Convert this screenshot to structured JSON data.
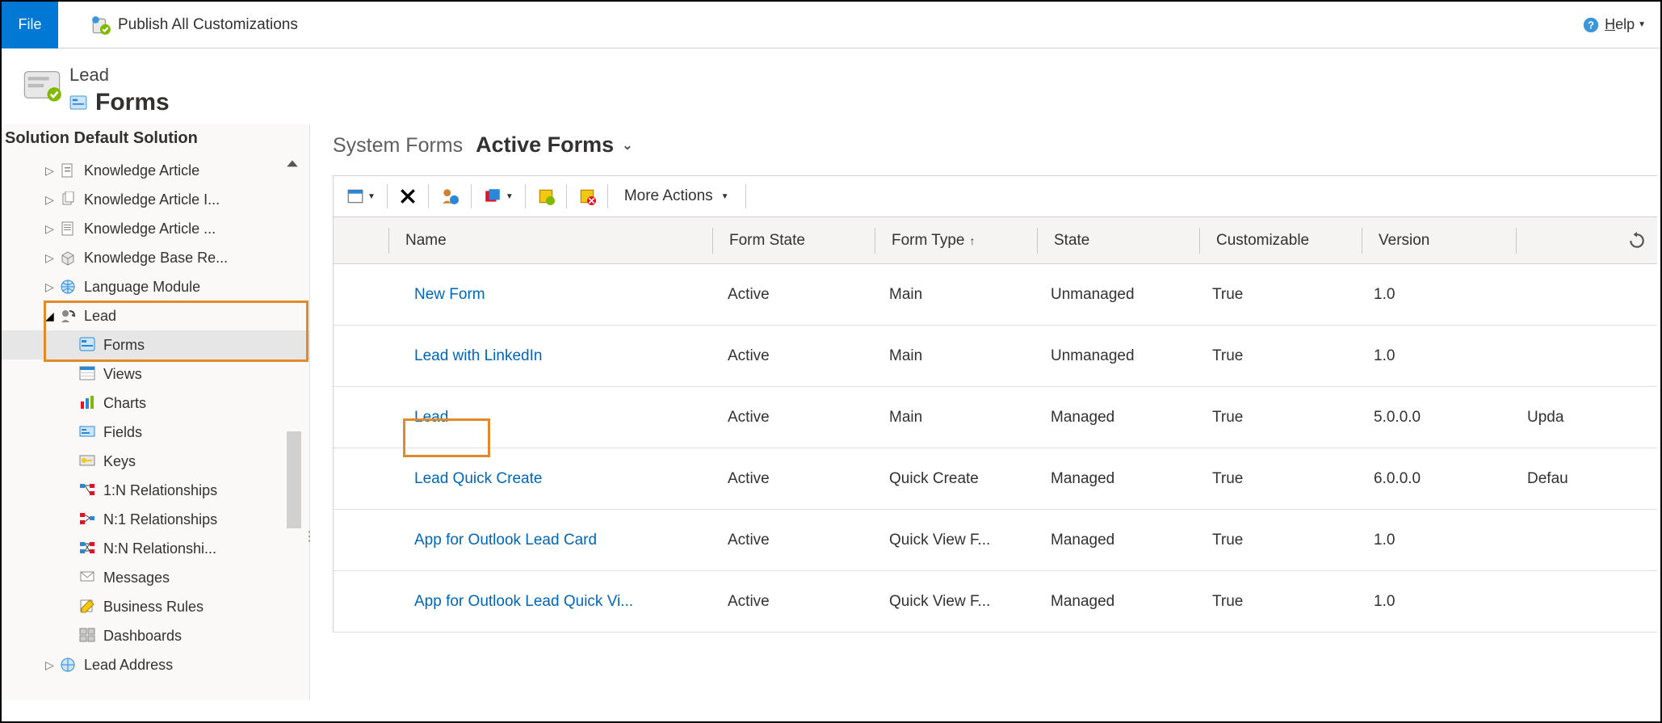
{
  "ribbon": {
    "file_label": "File",
    "publish_label": "Publish All Customizations",
    "help_label": "elp",
    "help_prefix": "H"
  },
  "header": {
    "entity_name": "Lead",
    "section_title": "Forms"
  },
  "sidebar": {
    "solution_label": "Solution Default Solution",
    "items": [
      {
        "label": "Knowledge Article",
        "icon": "doc"
      },
      {
        "label": "Knowledge Article I...",
        "icon": "doc-stack"
      },
      {
        "label": "Knowledge Article ...",
        "icon": "doc-lines"
      },
      {
        "label": "Knowledge Base Re...",
        "icon": "box"
      },
      {
        "label": "Language Module",
        "icon": "globe"
      }
    ],
    "lead_label": "Lead",
    "lead_children": [
      {
        "label": "Forms",
        "icon": "form",
        "selected": true
      },
      {
        "label": "Views",
        "icon": "view"
      },
      {
        "label": "Charts",
        "icon": "chart"
      },
      {
        "label": "Fields",
        "icon": "fields"
      },
      {
        "label": "Keys",
        "icon": "key"
      },
      {
        "label": "1:N Relationships",
        "icon": "rel"
      },
      {
        "label": "N:1 Relationships",
        "icon": "rel"
      },
      {
        "label": "N:N Relationshi...",
        "icon": "rel"
      },
      {
        "label": "Messages",
        "icon": "msg"
      },
      {
        "label": "Business Rules",
        "icon": "rules"
      },
      {
        "label": "Dashboards",
        "icon": "dash"
      }
    ],
    "after_lead": {
      "label": "Lead Address",
      "icon": "globe"
    }
  },
  "main": {
    "view_static": "System Forms",
    "view_selected": "Active Forms",
    "more_actions": "More Actions",
    "columns": {
      "name": "Name",
      "form_state": "Form State",
      "form_type": "Form Type",
      "state": "State",
      "customizable": "Customizable",
      "version": "Version"
    },
    "rows": [
      {
        "name": "New Form",
        "form_state": "Active",
        "form_type": "Main",
        "state": "Unmanaged",
        "customizable": "True",
        "version": "1.0",
        "desc": ""
      },
      {
        "name": "Lead with LinkedIn",
        "form_state": "Active",
        "form_type": "Main",
        "state": "Unmanaged",
        "customizable": "True",
        "version": "1.0",
        "desc": ""
      },
      {
        "name": "Lead",
        "form_state": "Active",
        "form_type": "Main",
        "state": "Managed",
        "customizable": "True",
        "version": "5.0.0.0",
        "desc": "Upda",
        "highlight": true
      },
      {
        "name": "Lead Quick Create",
        "form_state": "Active",
        "form_type": "Quick Create",
        "state": "Managed",
        "customizable": "True",
        "version": "6.0.0.0",
        "desc": "Defau"
      },
      {
        "name": "App for Outlook Lead Card",
        "form_state": "Active",
        "form_type": "Quick View F...",
        "state": "Managed",
        "customizable": "True",
        "version": "1.0",
        "desc": ""
      },
      {
        "name": "App for Outlook Lead Quick Vi...",
        "form_state": "Active",
        "form_type": "Quick View F...",
        "state": "Managed",
        "customizable": "True",
        "version": "1.0",
        "desc": ""
      }
    ]
  }
}
